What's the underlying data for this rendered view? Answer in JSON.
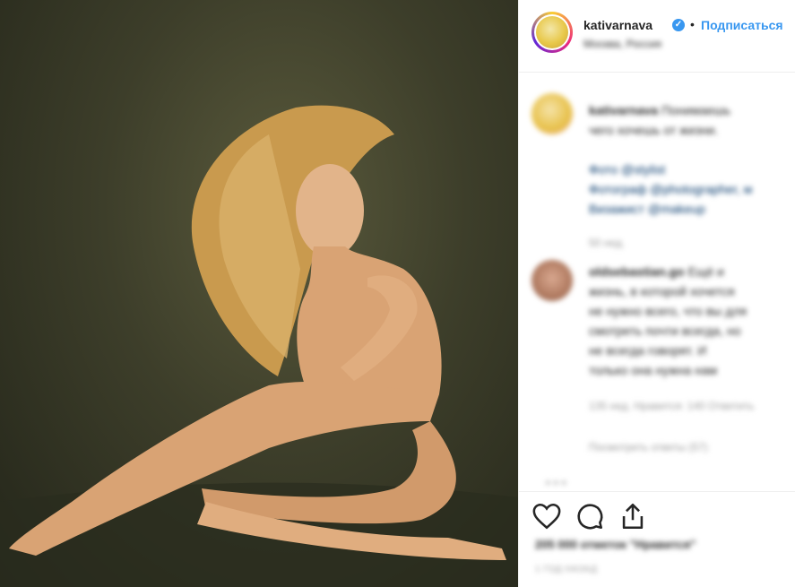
{
  "post": {
    "username": "kativarnava",
    "verified_badge": "✓",
    "separator": "•",
    "follow_label": "Подписаться",
    "location": "Москва, Россия"
  },
  "comments": [
    {
      "author": "kativarnava",
      "lines": [
        "Понимаешь",
        "чего хочешь от жизни.",
        "",
        "Фото @stylist",
        "Фотограф @photographer, м",
        "Визажист @makeup"
      ],
      "meta": "50 нед."
    },
    {
      "author": "oldsebastian.go",
      "lines": [
        "Ещё и",
        "жизнь, в которой хочется",
        "не нужно всего, что вы для",
        "смотреть почти всегда, но",
        "не всегда говорят. И",
        "только она нужна нам"
      ],
      "meta": "135 нед.   Нравится: 140   Ответить",
      "replies": "Посмотреть ответы (57)"
    }
  ],
  "likes_text": "205 000 отметок \"Нравится\"",
  "time_text": "1 ГОД НАЗАД",
  "icons": {
    "verified": "verified-badge-icon",
    "like": "heart-icon",
    "comment": "comment-icon",
    "share": "share-icon",
    "more": "more-dots-icon"
  },
  "colors": {
    "accent": "#3897f0",
    "text": "#262626",
    "muted": "#999999"
  }
}
